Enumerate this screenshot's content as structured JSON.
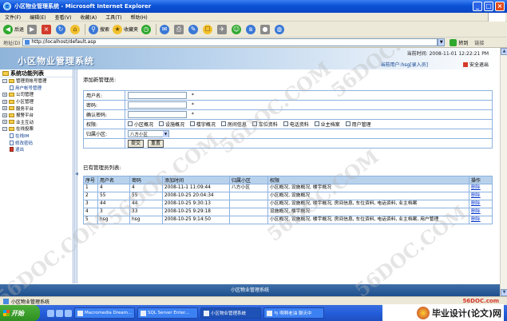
{
  "window": {
    "title": "小区物业管理系统 - Microsoft Internet Explorer"
  },
  "menubar": [
    "文件(F)",
    "编辑(E)",
    "查看(V)",
    "收藏(A)",
    "工具(T)",
    "帮助(H)"
  ],
  "toolbar": {
    "back": "后退",
    "search": "搜索",
    "favorites": "收藏夹"
  },
  "address": {
    "label": "地址(D)",
    "url": "http://localhost/default.asp",
    "go": "转到",
    "links": "链接"
  },
  "header": {
    "site_title": "小区物业管理系统",
    "time": "当前时间: 2008-11-01 12:22:21 PM",
    "user": "当前用户:hsg[录入员]",
    "logout": "安全退出"
  },
  "sidebar": {
    "title": "系统功能列表",
    "items": [
      {
        "label": "管理员帐号管理",
        "level": 0,
        "open": true
      },
      {
        "label": "用户帐号管理",
        "level": 1,
        "open": false
      },
      {
        "label": "公司管理",
        "level": 0,
        "open": false
      },
      {
        "label": "小区管理",
        "level": 0,
        "open": false
      },
      {
        "label": "服务平台",
        "level": 0,
        "open": false
      },
      {
        "label": "报警平台",
        "level": 0,
        "open": false
      },
      {
        "label": "业主互动",
        "level": 0,
        "open": false
      },
      {
        "label": "在线投票",
        "level": 0,
        "open": true
      },
      {
        "label": "在线IM",
        "level": 1,
        "open": false
      },
      {
        "label": "修改密码",
        "level": 1,
        "open": false
      },
      {
        "label": "退出",
        "level": 1,
        "open": false
      }
    ]
  },
  "form": {
    "section_title": "添加新管理员:",
    "username_label": "用户名:",
    "password_label": "密码:",
    "confirm_label": "确认密码:",
    "required_mark": "*",
    "permission_label": "权限:",
    "permissions": [
      "小区概况",
      "设施概况",
      "楼宇概况",
      "房间信息",
      "车位资料",
      "电话资料",
      "业主档案",
      "用户管理"
    ],
    "community_label": "归属小区:",
    "community_value": "八方小区",
    "submit_label": "提交",
    "reset_label": "重置"
  },
  "list": {
    "title": "已有管理员列表:",
    "columns": [
      "序号",
      "用户名",
      "密码",
      "添加时间",
      "归属小区",
      "权限",
      "操作"
    ],
    "rows": [
      [
        "1",
        "4",
        "4",
        "2008-11-1 11:09:44",
        "八方小区",
        "小区概况, 设施概况, 楼宇概况",
        "删除"
      ],
      [
        "2",
        "55",
        "55",
        "2008-10-25 20:04:34",
        "",
        "小区概况, 设施概况",
        "删除"
      ],
      [
        "3",
        "44",
        "44",
        "2008-10-25 9:30:13",
        "",
        "小区概况, 设施概况, 楼宇概况, 房间信息, 车位资料, 电话资料, 业主档案",
        "删除"
      ],
      [
        "4",
        "3",
        "33",
        "2008-10-25 9:29:18",
        "",
        "设施概况, 楼宇概况",
        "删除"
      ],
      [
        "5",
        "hsg",
        "hsg",
        "2008-10-25 9:14:50",
        "",
        "小区概况, 设施概况, 楼宇概况, 房间信息, 车位资料, 电话资料, 业主档案, 用户管理",
        "删除"
      ]
    ]
  },
  "footer": {
    "text": "小区物业管理系统"
  },
  "statusbar": {
    "text": "小区物业管理系统"
  },
  "taskbar": {
    "start": "开始",
    "tasks": [
      "Macromedia Dream...",
      "SQL Server Enter...",
      "小区物业管理系统",
      "与 啊啊老油 聊天中"
    ]
  },
  "watermark": {
    "site": "56DOC.COM",
    "brand": "毕业设计(论文)网",
    "brand_domain": "56DOC.com"
  },
  "colors": {
    "titlebar": "#0b52d6",
    "header_gradient_start": "#8fb4da",
    "table_border": "#8db2e0",
    "table_header": "#b9d2ec",
    "link": "#0033cc"
  }
}
